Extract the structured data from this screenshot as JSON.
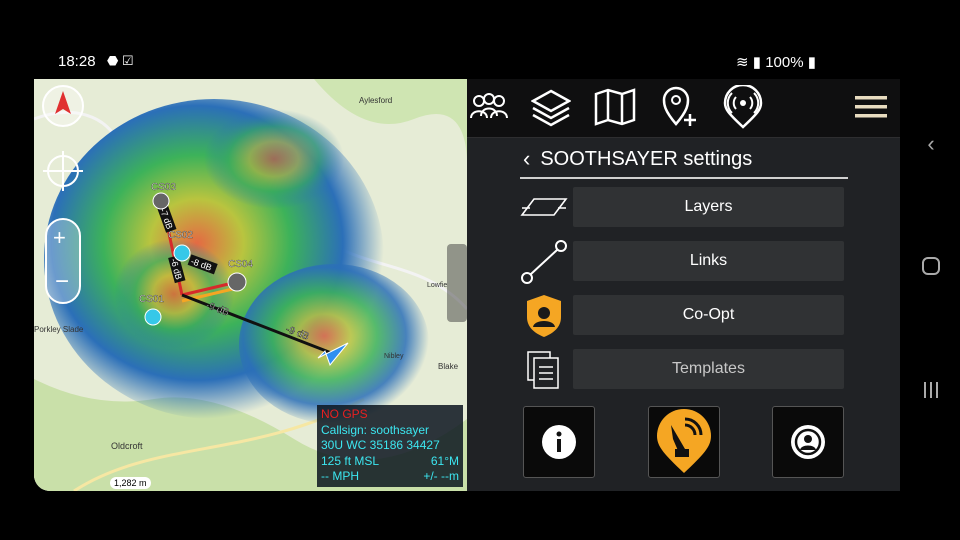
{
  "status": {
    "time": "18:28",
    "battery": "100%"
  },
  "map": {
    "places": [
      {
        "name": "Aylesford"
      },
      {
        "name": "Lowfie"
      },
      {
        "name": "Porkley Slade"
      },
      {
        "name": "Oldcroft"
      },
      {
        "name": "Blake"
      },
      {
        "name": "Nibley"
      }
    ],
    "nodes": [
      "CS03",
      "CS02",
      "CS04",
      "CS01"
    ],
    "links": [
      "-7 dB",
      "-6 dB",
      "-8 dB",
      "-9 dB",
      "-9 dB"
    ],
    "scale": "1,282 m",
    "gps": {
      "status": "NO GPS",
      "callsign": "Callsign: soothsayer",
      "grid": "30U  WC  35186  34427",
      "alt": "125 ft MSL",
      "heading": "61°M",
      "speed": "-- MPH",
      "acc": "+/- --m"
    }
  },
  "panel": {
    "title": "SOOTHSAYER settings",
    "rows": [
      {
        "label": "Layers"
      },
      {
        "label": "Links"
      },
      {
        "label": "Co-Opt"
      },
      {
        "label": "Templates"
      }
    ]
  },
  "colors": {
    "accent": "#f5a623",
    "panel": "#202225",
    "button": "#303234"
  }
}
